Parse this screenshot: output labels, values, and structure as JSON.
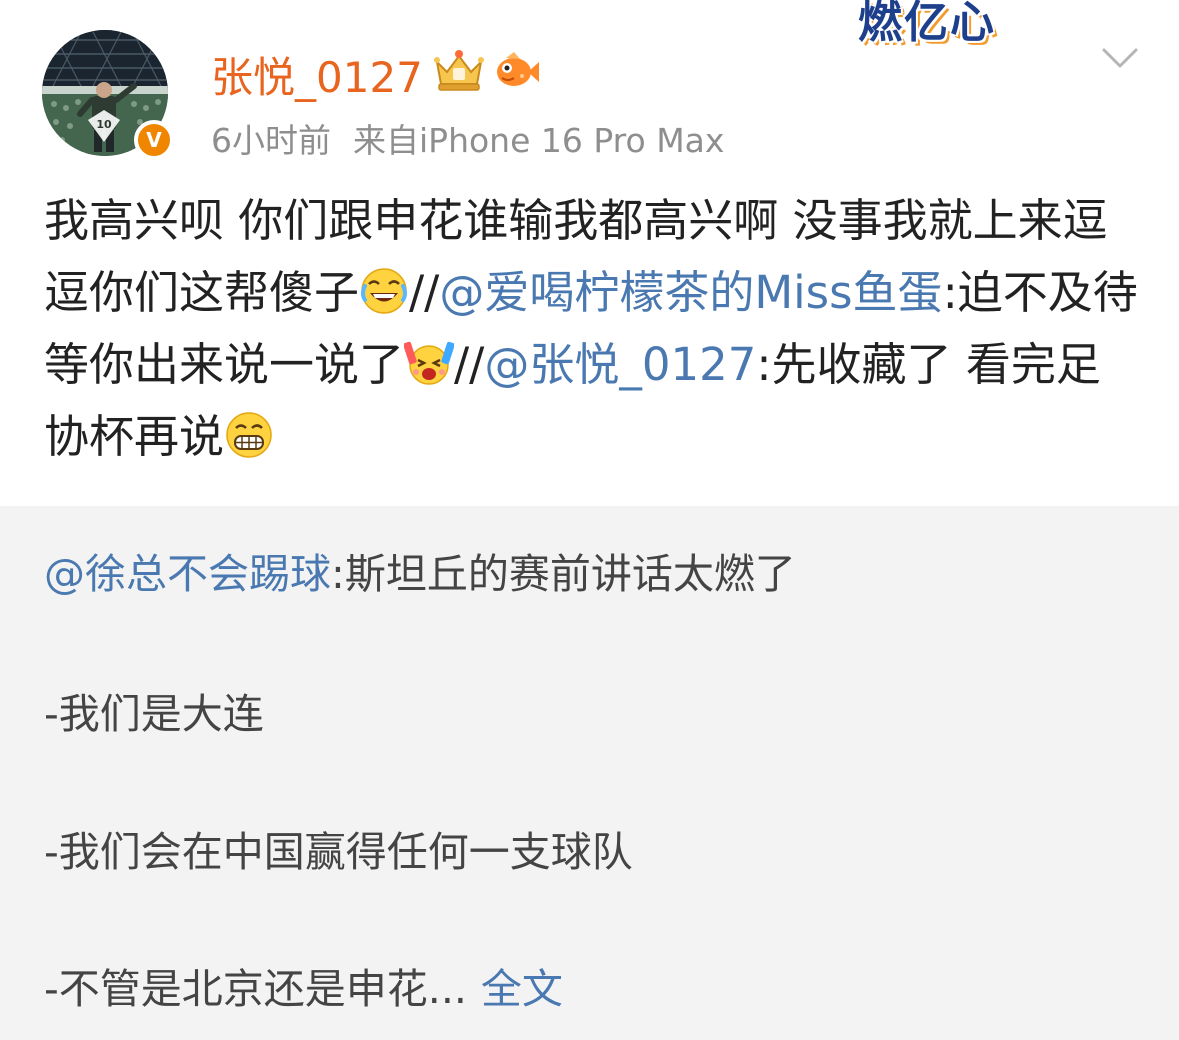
{
  "post": {
    "author": {
      "name": "张悦_0127",
      "verified_badge": "V",
      "avatar_icon": "stadium-avatar",
      "badges": [
        "crown-icon",
        "fish-icon"
      ]
    },
    "time": "6小时前",
    "source": "来自iPhone 16 Pro Max",
    "banner_text": "燃亿心",
    "menu_icon": "chevron-down-icon",
    "content": {
      "seg1": "我高兴呗 你们跟申花谁输我都高兴啊 没事我就上来逗逗你们这帮傻子",
      "emoji1": "laugh-cry-emoji",
      "slashes1": "//",
      "mention1": "@爱喝柠檬茶的Miss鱼蛋",
      "seg2": ":迫不及待等你出来说一说了",
      "emoji2": "cheer-emoji",
      "slashes2": "//",
      "mention2": "@张悦_0127",
      "seg3": ":先收藏了 看完足协杯再说",
      "emoji3": "grin-emoji"
    }
  },
  "retweet": {
    "mention": "@徐总不会踢球",
    "text": ":斯坦丘的赛前讲话太燃了",
    "line1": "-我们是大连",
    "line2": "-我们会在中国赢得任何一支球队",
    "line3": "-不管是北京还是申花...",
    "full_link": "全文"
  },
  "colors": {
    "username": "#e8641f",
    "mention": "#4a78b0",
    "meta": "#8e8e8e",
    "retweet_bg": "#f3f3f3",
    "verified": "#f08500"
  }
}
